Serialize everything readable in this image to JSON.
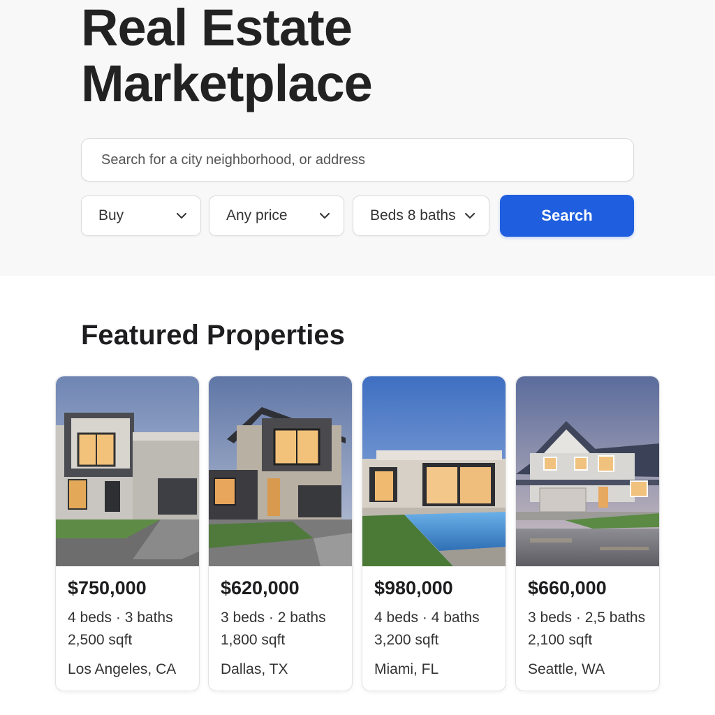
{
  "hero": {
    "title_line1": "Real Estate",
    "title_line2": "Marketplace",
    "search_placeholder": "Search for a city neighborhood, or address"
  },
  "filters": {
    "type": "Buy",
    "price": "Any price",
    "beds_baths": "Beds 8 baths",
    "search_button": "Search"
  },
  "featured": {
    "heading": "Featured Properties",
    "properties": [
      {
        "price": "$750,000",
        "specs": "4 beds · 3 baths",
        "sqft": "2,500 sqft",
        "location": "Los Angeles, CA"
      },
      {
        "price": "$620,000",
        "specs": "3 beds · 2 baths",
        "sqft": "1,800 sqft",
        "location": "Dallas, TX"
      },
      {
        "price": "$980,000",
        "specs": "4 beds · 4 baths",
        "sqft": "3,200 sqft",
        "location": "Miami, FL"
      },
      {
        "price": "$660,000",
        "specs": "3 beds · 2,5 baths",
        "sqft": "2,100 sqft",
        "location": "Seattle, WA"
      }
    ]
  },
  "colors": {
    "accent": "#1f5fdf",
    "hero_bg": "#f8f8f9"
  },
  "icons": {
    "dropdown": "chevron-down-icon"
  }
}
